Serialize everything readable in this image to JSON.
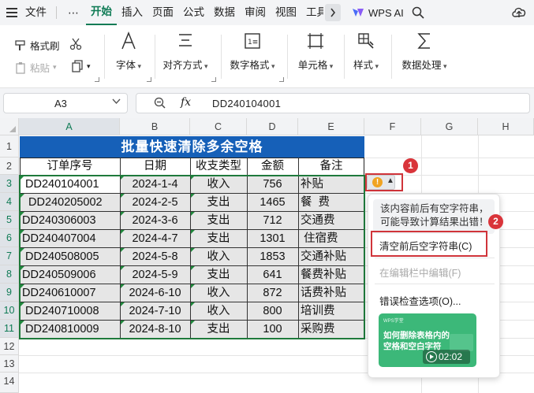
{
  "menubar": {
    "items": [
      "文件",
      "开始",
      "插入",
      "页面",
      "公式",
      "数据",
      "审阅",
      "视图",
      "工具"
    ],
    "more": "⋯",
    "wps_ai": "WPS AI",
    "active": "开始"
  },
  "ribbon": {
    "format_painter": "格式刷",
    "paste": "粘贴",
    "font": "字体",
    "alignment": "对齐方式",
    "number_format": "数字格式",
    "cell": "单元格",
    "style": "样式",
    "data_processing": "数据处理"
  },
  "formula_bar": {
    "name_box": "A3",
    "fx": "fx",
    "value": "DD240104001"
  },
  "grid": {
    "columns": [
      "A",
      "B",
      "C",
      "D",
      "E",
      "F",
      "G",
      "H"
    ],
    "rows": [
      "1",
      "2",
      "3",
      "4",
      "5",
      "6",
      "7",
      "8",
      "9",
      "10",
      "11",
      "12",
      "13",
      "14"
    ],
    "title": "批量快速清除多余空格",
    "headers": [
      "订单序号",
      "日期",
      "收支类型",
      "金额",
      "备注"
    ],
    "data": [
      [
        " DD240104001",
        "2024-1-4",
        "收入",
        "756",
        "补贴"
      ],
      [
        "  DD240205002",
        "2024-2-5",
        "支出",
        "1465",
        "餐  费"
      ],
      [
        "DD240306003",
        "2024-3-6",
        "支出",
        "712",
        "交通费"
      ],
      [
        "DD240407004",
        "2024-4-7",
        "支出",
        "1301",
        " 住宿费"
      ],
      [
        " DD240508005",
        "2024-5-8",
        "收入",
        "1853",
        "交通补贴"
      ],
      [
        "DD240509006",
        "2024-5-9",
        "支出",
        "641",
        "餐费补贴"
      ],
      [
        "DD240610007",
        "2024-6-10",
        "收入",
        "872",
        "话费补贴"
      ],
      [
        " DD240710008",
        "2024-7-10",
        "收入",
        "800",
        "培训费"
      ],
      [
        " DD240810009",
        "2024-8-10",
        "支出",
        "100",
        "采购费"
      ]
    ]
  },
  "error_popup": {
    "description": "该内容前后有空字符串，可能导致计算结果出错！",
    "items": [
      "清空前后空字符串(C)",
      "在编辑栏中编辑(F)",
      "错误检查选项(O)..."
    ],
    "video": {
      "brand": "WPS学堂",
      "title": "如何删除表格内的\n空格和空白字符",
      "duration": "02:02"
    }
  },
  "annotations": [
    "1",
    "2"
  ],
  "colors": {
    "accent": "#0f7b55",
    "title_fill": "#1660b8",
    "selection_border": "#1f7a3c",
    "callout_red": "#d0343a",
    "warning": "#f0a321"
  }
}
